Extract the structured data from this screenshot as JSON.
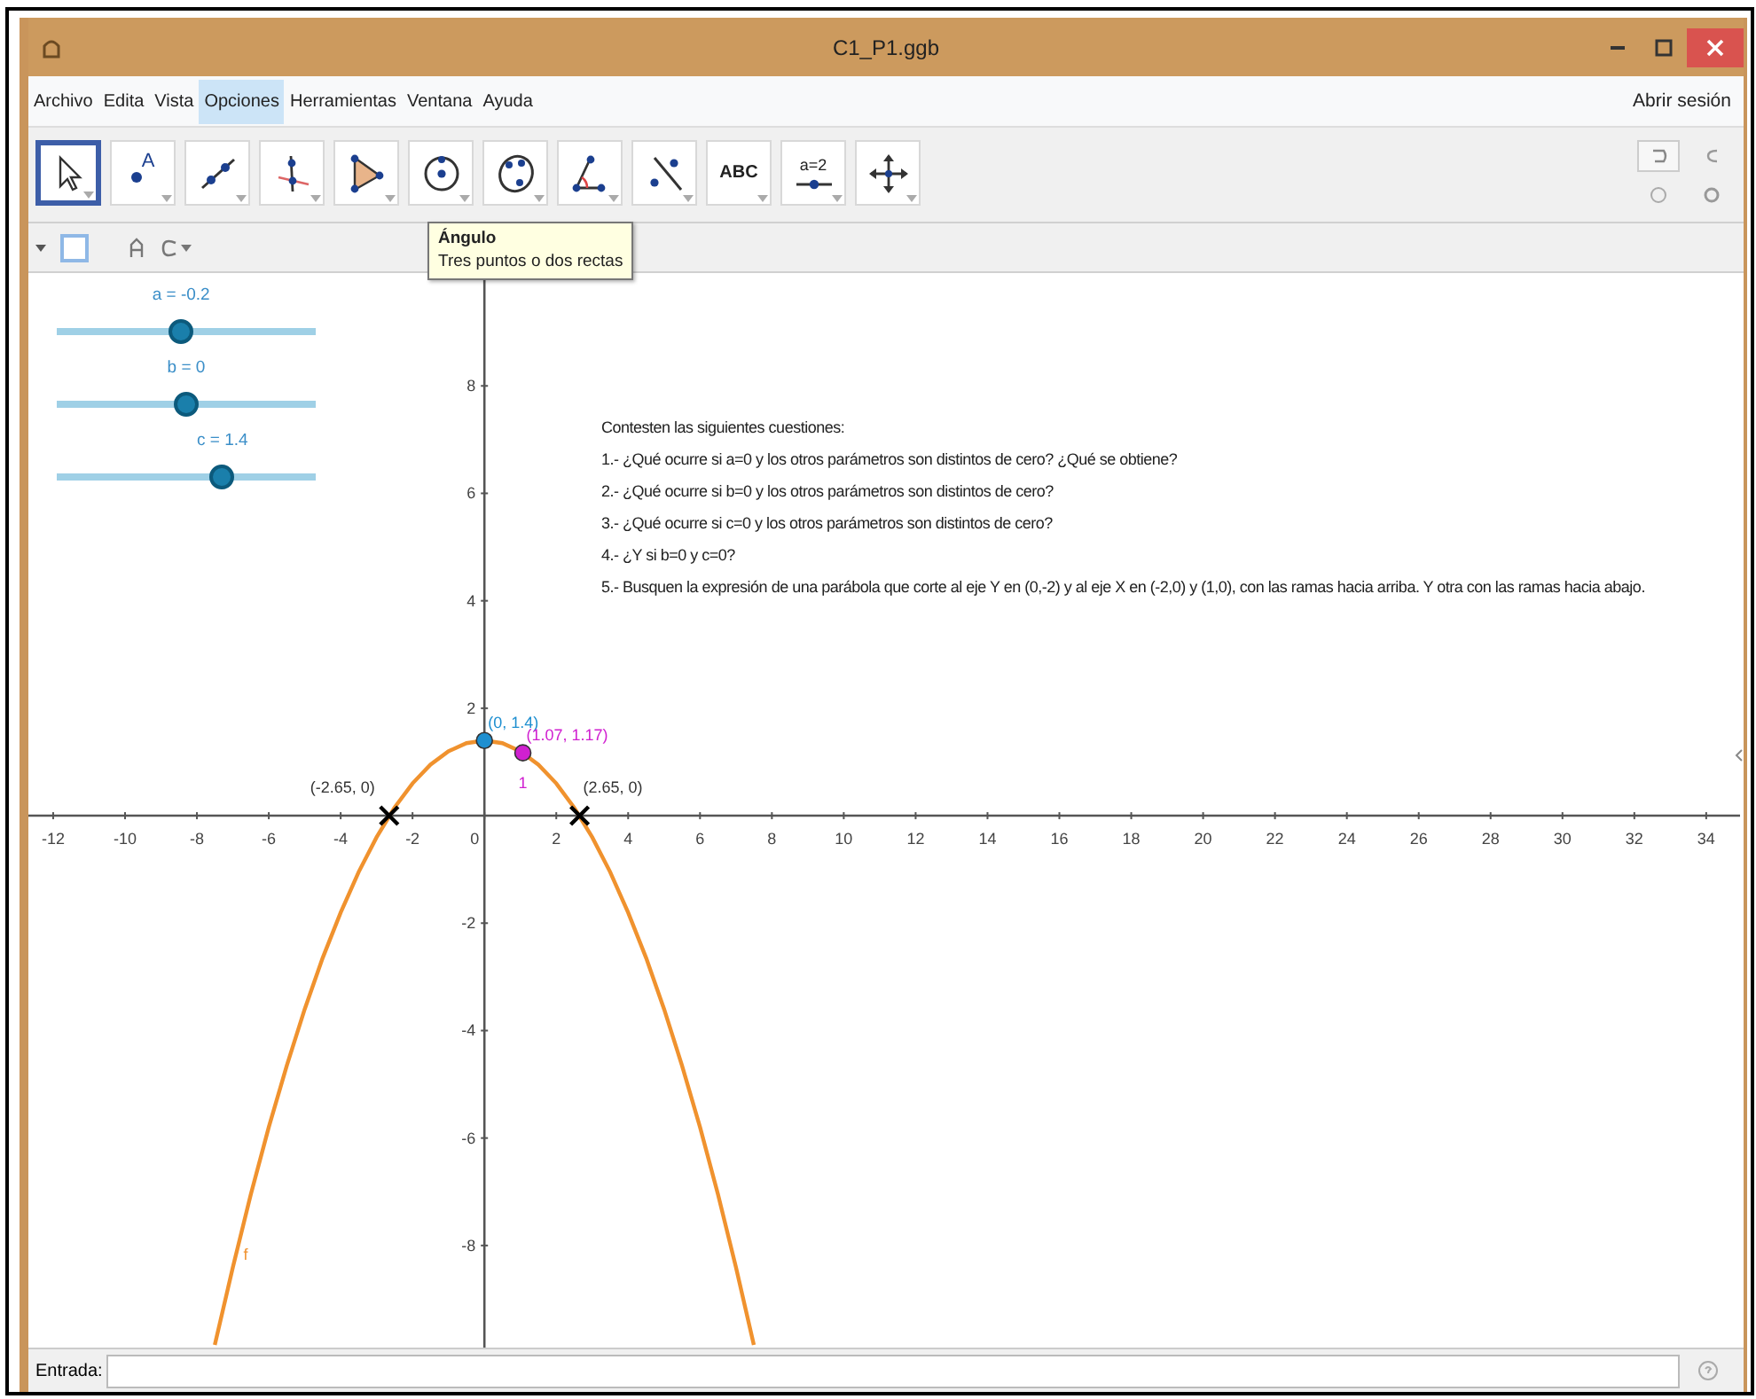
{
  "window": {
    "title": "C1_P1.ggb"
  },
  "menu": {
    "items": [
      {
        "label": "Archivo",
        "selected": false
      },
      {
        "label": "Edita",
        "selected": false
      },
      {
        "label": "Vista",
        "selected": false
      },
      {
        "label": "Opciones",
        "selected": true
      },
      {
        "label": "Herramientas",
        "selected": false
      },
      {
        "label": "Ventana",
        "selected": false
      },
      {
        "label": "Ayuda",
        "selected": false
      }
    ],
    "sign_in": "Abrir sesión"
  },
  "toolbar": {
    "tools": [
      {
        "kind": "move",
        "selected": true
      },
      {
        "kind": "point",
        "label": "A",
        "selected": false
      },
      {
        "kind": "line",
        "selected": false
      },
      {
        "kind": "perpendicular",
        "selected": false
      },
      {
        "kind": "polygon",
        "selected": false
      },
      {
        "kind": "circle",
        "selected": false
      },
      {
        "kind": "conic",
        "selected": false
      },
      {
        "kind": "angle",
        "selected": false
      },
      {
        "kind": "reflect",
        "selected": false
      },
      {
        "kind": "text",
        "label": "ABC",
        "selected": false
      },
      {
        "kind": "slider",
        "label": "a=2",
        "selected": false
      },
      {
        "kind": "pan",
        "selected": false
      }
    ]
  },
  "tooltip": {
    "title": "Ángulo",
    "text": "Tres puntos o dos rectas"
  },
  "graphics": {
    "sliders": [
      {
        "label": "a = -0.2",
        "level": 0.48
      },
      {
        "label": "b = 0",
        "level": 0.5
      },
      {
        "label": "c = 1.4",
        "level": 0.64
      }
    ],
    "questions": {
      "heading": "Contesten las siguientes cuestiones:",
      "items": [
        "1.- ¿Qué ocurre si a=0 y los otros parámetros son distintos de cero? ¿Qué se obtiene?",
        "2.- ¿Qué ocurre si b=0 y los otros parámetros son distintos de cero?",
        "3.- ¿Qué ocurre si c=0 y los otros parámetros son distintos de cero?",
        "4.- ¿Y si b=0 y c=0?",
        "5.- Busquen la expresión de una parábola que corte al eje Y en (0,-2) y al eje X en (-2,0) y (1,0), con las ramas hacia arriba. Y otra con las ramas hacia abajo."
      ]
    },
    "chart_data": {
      "type": "line",
      "x": [
        -7.5,
        -7,
        -6.5,
        -6,
        -5.5,
        -5,
        -4.5,
        -4,
        -3.5,
        -3,
        -2.5,
        -2,
        -1.5,
        -1,
        -0.5,
        0,
        0.5,
        1,
        1.5,
        2,
        2.5,
        3,
        3.5,
        4,
        4.5,
        5,
        5.5,
        6,
        6.5,
        7,
        7.5
      ],
      "series": [
        {
          "name": "f",
          "color": "#f0922e",
          "values": [
            -9.85,
            -8.4,
            -7.05,
            -5.8,
            -4.65,
            -3.6,
            -2.65,
            -1.8,
            -1.05,
            -0.4,
            0.15,
            0.6,
            0.95,
            1.2,
            1.35,
            1.4,
            1.35,
            1.2,
            0.95,
            0.6,
            0.15,
            -0.4,
            -1.05,
            -1.8,
            -2.65,
            -3.6,
            -4.65,
            -5.8,
            -7.05,
            -8.4,
            -9.85
          ]
        }
      ],
      "xlim": [
        -12.69,
        35.04
      ],
      "ylim": [
        -9.9,
        10.1
      ],
      "xticks": [
        -12,
        -10,
        -8,
        -6,
        -4,
        -2,
        0,
        2,
        4,
        6,
        8,
        10,
        12,
        14,
        16,
        18,
        20,
        22,
        24,
        26,
        28,
        30,
        32,
        34
      ],
      "yticks": [
        8,
        6,
        4,
        2,
        -2,
        -4,
        -6,
        -8
      ],
      "annotations": [
        {
          "x": -2.65,
          "y": 0,
          "text": "(-2.65, 0)"
        },
        {
          "x": 2.65,
          "y": 0,
          "text": "(2.65, 0)"
        },
        {
          "x": 0,
          "y": 1.4,
          "text": "(0, 1.4)"
        },
        {
          "x": 1.07,
          "y": 1.17,
          "text": "(1.07, 1.17)"
        }
      ]
    },
    "markers": [
      {
        "kind": "cross",
        "color": "#000000"
      },
      {
        "kind": "cross",
        "color": "#000000"
      },
      {
        "kind": "point",
        "color": "#1e8fd0"
      },
      {
        "kind": "point",
        "color": "#d020d0",
        "index_label": "1"
      }
    ]
  },
  "input_bar": {
    "label": "Entrada:"
  }
}
